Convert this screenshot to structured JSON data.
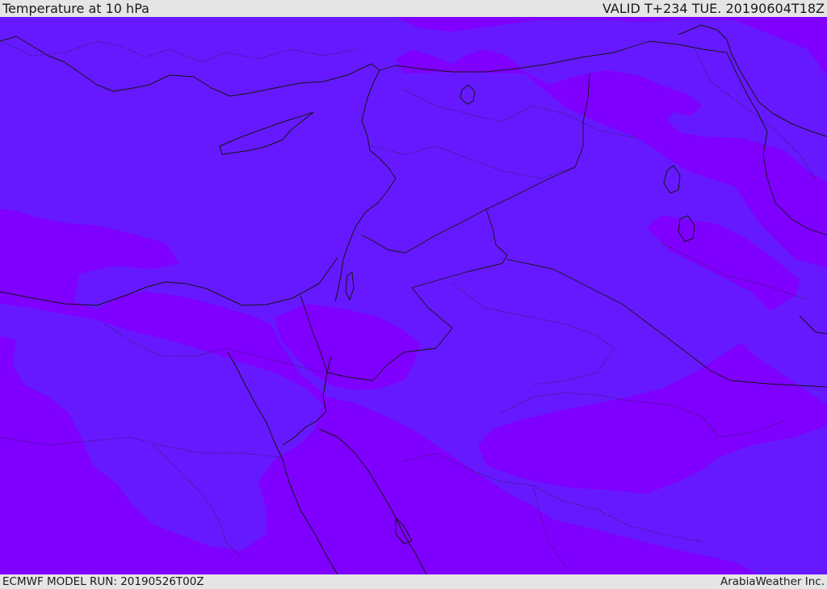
{
  "header": {
    "title": "Temperature at 10 hPa",
    "valid_time": "VALID T+234 TUE. 20190604T18Z"
  },
  "footer": {
    "model_run": "ECMWF MODEL RUN: 20190526T00Z",
    "credit": "ArabiaWeather Inc."
  },
  "colors": {
    "band_warm": "#7f00ff",
    "band_cool": "#6619ff",
    "frame": "#e5e5e5",
    "lines": "#141414"
  }
}
